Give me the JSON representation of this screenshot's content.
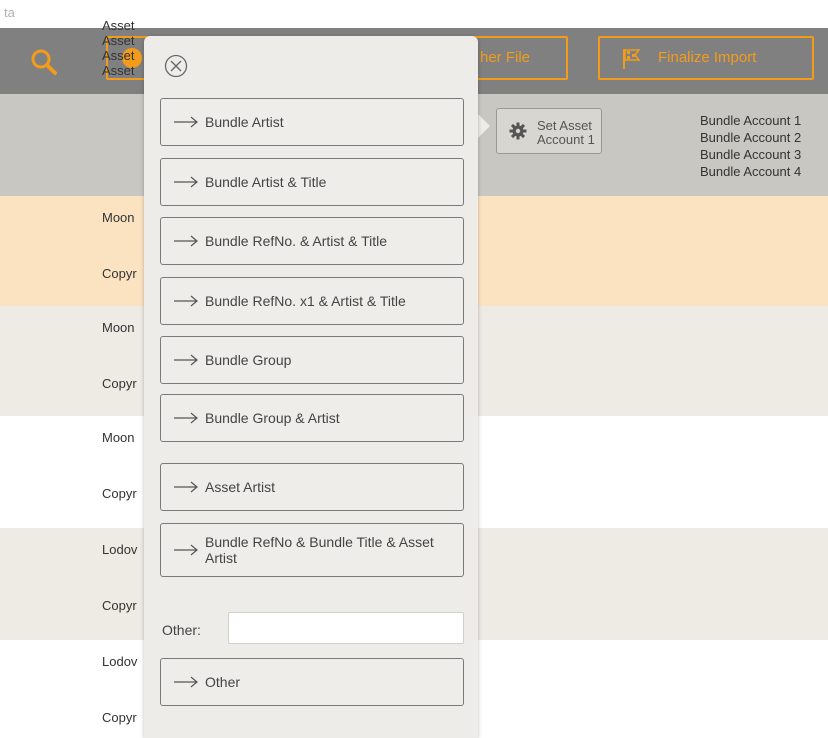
{
  "window": {
    "title_fragment": "ta"
  },
  "toolbar": {
    "other_file_label": "her File",
    "finalize_label": "Finalize Import",
    "accent_color": "#f39c1a"
  },
  "asset_account_section": {
    "asset_lines": [
      "Asset",
      "Asset",
      "Asset",
      "Asset"
    ],
    "set_asset_button": {
      "line1": "Set Asset",
      "line2": "Account 1"
    },
    "bundle_accounts": [
      "Bundle Account 1",
      "Bundle Account 2",
      "Bundle Account 3",
      "Bundle Account 4"
    ]
  },
  "rows": [
    {
      "line1": "Moon",
      "line2": "Copyr",
      "background": "#fbe3c2"
    },
    {
      "line1": "Moon",
      "line2": "Copyr",
      "background": "#eeebe5"
    },
    {
      "line1": "Moon",
      "line2": "Copyr",
      "background": "#ffffff"
    },
    {
      "line1": "Lodov",
      "line2": "Copyr",
      "background": "#eeebe5"
    },
    {
      "line1": "Lodov",
      "line2": "Copyr",
      "background": "#ffffff"
    }
  ],
  "popup": {
    "options": [
      "Bundle Artist",
      "Bundle Artist & Title",
      "Bundle RefNo. & Artist & Title",
      "Bundle RefNo. x1 & Artist & Title",
      "Bundle Group",
      "Bundle Group & Artist",
      "Asset Artist",
      "Bundle RefNo & Bundle Title & Asset Artist"
    ],
    "other_label": "Other:",
    "other_input_value": "",
    "other_button": "Other"
  }
}
